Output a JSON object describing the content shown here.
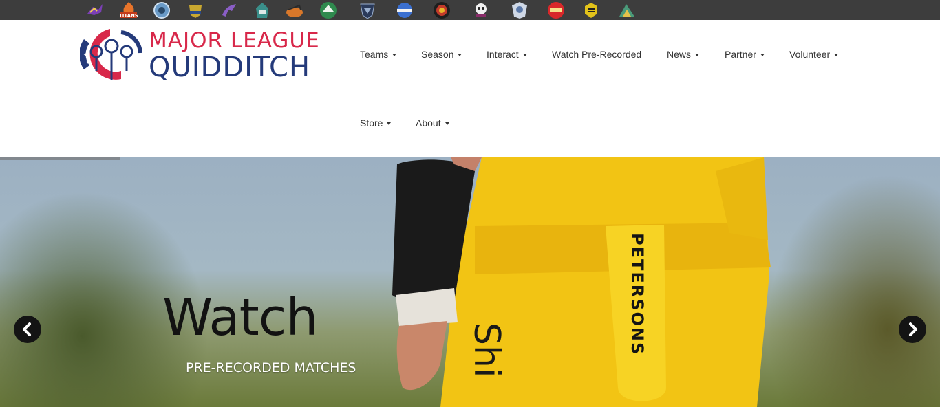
{
  "team_bar": {
    "teams": [
      {
        "name": "team-logo-1",
        "color": "#7b3fb5"
      },
      {
        "name": "team-logo-titans",
        "text": "TITANS",
        "color": "#e8742a"
      },
      {
        "name": "team-logo-3",
        "color": "#6a9bc8"
      },
      {
        "name": "team-logo-4",
        "color": "#c9a830"
      },
      {
        "name": "team-logo-5",
        "color": "#8a5ec6"
      },
      {
        "name": "team-logo-6",
        "color": "#3a8f8a"
      },
      {
        "name": "team-logo-7",
        "color": "#d9782a"
      },
      {
        "name": "team-logo-whiteout",
        "color": "#2f8a4e"
      },
      {
        "name": "team-logo-9",
        "color": "#2a3a5a"
      },
      {
        "name": "team-logo-legends",
        "color": "#3a6fd0"
      },
      {
        "name": "team-logo-11",
        "color": "#c23a2a"
      },
      {
        "name": "team-logo-curse",
        "color": "#8a2c6a"
      },
      {
        "name": "team-logo-13",
        "color": "#cfd8e6"
      },
      {
        "name": "team-logo-sol",
        "color": "#d8282a"
      },
      {
        "name": "team-logo-hive",
        "color": "#e2c21a"
      },
      {
        "name": "team-logo-16",
        "color": "#4a9a7a"
      }
    ]
  },
  "brand": {
    "line1": "MAJOR LEAGUE",
    "line2": "QUIDDITCH",
    "primary_color": "#243a7a",
    "accent_color": "#d8284a"
  },
  "nav": {
    "items": [
      {
        "label": "Teams",
        "dropdown": true
      },
      {
        "label": "Season",
        "dropdown": true
      },
      {
        "label": "Interact",
        "dropdown": true
      },
      {
        "label": "Watch Pre-Recorded",
        "dropdown": false
      },
      {
        "label": "News",
        "dropdown": true
      },
      {
        "label": "Partner",
        "dropdown": true
      },
      {
        "label": "Volunteer",
        "dropdown": true
      },
      {
        "label": "Store",
        "dropdown": true
      },
      {
        "label": "About",
        "dropdown": true
      }
    ]
  },
  "hero": {
    "title": "Watch",
    "subtitle": "PRE-RECORDED MATCHES",
    "prev_icon": "chevron-left-icon",
    "next_icon": "chevron-right-icon",
    "jersey_text": "PETERSONS",
    "shirt_letters": "Shi"
  }
}
